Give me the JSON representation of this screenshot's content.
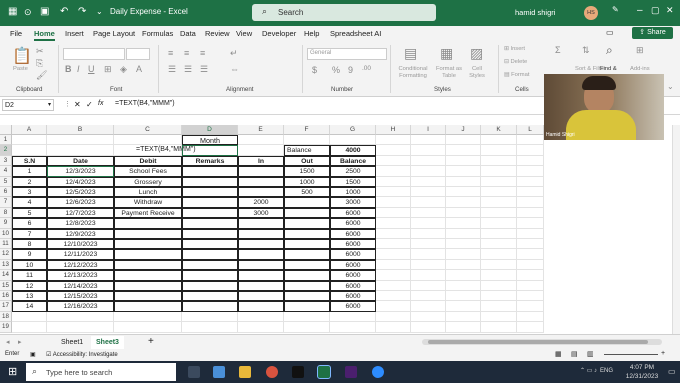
{
  "titlebar": {
    "autosave_icon": "autosave-icon",
    "file_name": "Daily Expense",
    "app": "Excel",
    "search_placeholder": "Search",
    "user_name": "hamid shigri",
    "user_initials": "HS"
  },
  "menu": [
    "File",
    "Home",
    "Insert",
    "Page Layout",
    "Formulas",
    "Data",
    "Review",
    "View",
    "Developer",
    "Help",
    "Spreadsheet AI"
  ],
  "share_label": "Share",
  "ribbon": {
    "groups": [
      "Clipboard",
      "Font",
      "Alignment",
      "Number",
      "Styles",
      "Cells"
    ],
    "paste_label": "Paste",
    "number_format": "General",
    "cond_format": "Conditional Formatting",
    "format_table": "Format as Table",
    "cell_styles": "Cell Styles",
    "insert": "Insert",
    "delete": "Delete",
    "format": "Format",
    "sort_filter": "Sort & Filter",
    "find_select": "Find &",
    "addins": "Add-ins"
  },
  "formula_bar": {
    "name_box": "D2",
    "formula": "=TEXT(B4,\"MMM\")"
  },
  "columns": [
    "A",
    "B",
    "C",
    "D",
    "E",
    "F",
    "G",
    "H",
    "I",
    "J",
    "K",
    "L"
  ],
  "rows": [
    "1",
    "2",
    "3",
    "4",
    "5",
    "6",
    "7",
    "8",
    "9",
    "10",
    "11",
    "12",
    "13",
    "14",
    "15",
    "16",
    "17",
    "18",
    "19"
  ],
  "cells": {
    "d1": "Month",
    "c2_edit": "=TEXT(B4,\"MMM\")",
    "f2": "Balance",
    "g2": "4000",
    "headers": [
      "S.N",
      "Date",
      "Debit",
      "Remarks",
      "In",
      "Out",
      "Balance"
    ]
  },
  "table": [
    {
      "sn": "1",
      "date": "12/3/2023",
      "debit": "School Fees",
      "in": "",
      "out": "1500",
      "bal": "2500"
    },
    {
      "sn": "2",
      "date": "12/4/2023",
      "debit": "Grossery",
      "in": "",
      "out": "1000",
      "bal": "1500"
    },
    {
      "sn": "3",
      "date": "12/5/2023",
      "debit": "Lunch",
      "in": "",
      "out": "500",
      "bal": "1000"
    },
    {
      "sn": "4",
      "date": "12/6/2023",
      "debit": "Withdraw",
      "in": "2000",
      "out": "",
      "bal": "3000"
    },
    {
      "sn": "5",
      "date": "12/7/2023",
      "debit": "Payment Receive",
      "in": "3000",
      "out": "",
      "bal": "6000"
    },
    {
      "sn": "6",
      "date": "12/8/2023",
      "debit": "",
      "in": "",
      "out": "",
      "bal": "6000"
    },
    {
      "sn": "7",
      "date": "12/9/2023",
      "debit": "",
      "in": "",
      "out": "",
      "bal": "6000"
    },
    {
      "sn": "8",
      "date": "12/10/2023",
      "debit": "",
      "in": "",
      "out": "",
      "bal": "6000"
    },
    {
      "sn": "9",
      "date": "12/11/2023",
      "debit": "",
      "in": "",
      "out": "",
      "bal": "6000"
    },
    {
      "sn": "10",
      "date": "12/12/2023",
      "debit": "",
      "in": "",
      "out": "",
      "bal": "6000"
    },
    {
      "sn": "11",
      "date": "12/13/2023",
      "debit": "",
      "in": "",
      "out": "",
      "bal": "6000"
    },
    {
      "sn": "12",
      "date": "12/14/2023",
      "debit": "",
      "in": "",
      "out": "",
      "bal": "6000"
    },
    {
      "sn": "13",
      "date": "12/15/2023",
      "debit": "",
      "in": "",
      "out": "",
      "bal": "6000"
    },
    {
      "sn": "14",
      "date": "12/16/2023",
      "debit": "",
      "in": "",
      "out": "",
      "bal": "6000"
    }
  ],
  "sheets": [
    "Sheet1",
    "Sheet3"
  ],
  "status": {
    "mode": "Enter",
    "accessibility": "Accessibility: Investigate"
  },
  "webcam_label": "Hamid Shigri",
  "taskbar": {
    "search": "Type here to search",
    "lang": "ENG",
    "time": "4:07 PM",
    "date": "12/31/2023"
  },
  "colors": {
    "excel_green": "#1e7145",
    "taskbar": "#1e2a3a"
  }
}
